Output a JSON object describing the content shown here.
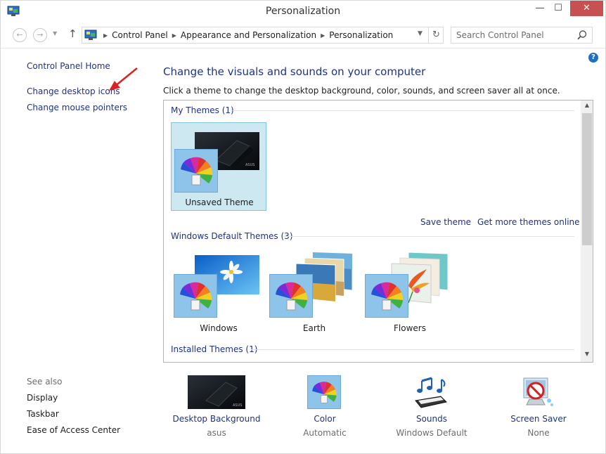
{
  "window": {
    "title": "Personalization",
    "minimize_glyph": "—",
    "maximize_glyph": "☐",
    "close_glyph": "✕"
  },
  "nav": {
    "back_glyph": "←",
    "forward_glyph": "→",
    "recent_glyph": "▼",
    "up_glyph": "↑",
    "breadcrumbs": [
      "Control Panel",
      "Appearance and Personalization",
      "Personalization"
    ],
    "crumb_separator": "▶",
    "dropdown_glyph": "▼",
    "refresh_glyph": "↻",
    "search_placeholder": "Search Control Panel"
  },
  "help": {
    "glyph": "?"
  },
  "left_pane": {
    "links": [
      "Control Panel Home",
      "Change desktop icons",
      "Change mouse pointers"
    ],
    "see_also_label": "See also",
    "see_also": [
      "Display",
      "Taskbar",
      "Ease of Access Center"
    ]
  },
  "main": {
    "heading": "Change the visuals and sounds on your computer",
    "subheading": "Click a theme to change the desktop background, color, sounds, and screen saver all at once."
  },
  "themes": {
    "my_themes_label": "My Themes (1)",
    "my_themes": [
      {
        "name": "Unsaved Theme",
        "selected": true
      }
    ],
    "save_theme_label": "Save theme",
    "get_more_label": "Get more themes online",
    "default_themes_label": "Windows Default Themes (3)",
    "default_themes": [
      {
        "name": "Windows"
      },
      {
        "name": "Earth"
      },
      {
        "name": "Flowers"
      }
    ],
    "installed_themes_label": "Installed Themes (1)",
    "scroll_up_glyph": "▲",
    "scroll_down_glyph": "▼"
  },
  "settings": [
    {
      "label": "Desktop Background",
      "value": "asus",
      "icon": "desktop-background-icon"
    },
    {
      "label": "Color",
      "value": "Automatic",
      "icon": "color-palette-icon"
    },
    {
      "label": "Sounds",
      "value": "Windows Default",
      "icon": "sounds-icon"
    },
    {
      "label": "Screen Saver",
      "value": "None",
      "icon": "screen-saver-icon"
    }
  ],
  "colors": {
    "link": "#1e3287",
    "selection_bg": "#cde8f0",
    "selection_border": "#7fc5da",
    "annotation_arrow": "#e02020",
    "close_button": "#c75050"
  }
}
